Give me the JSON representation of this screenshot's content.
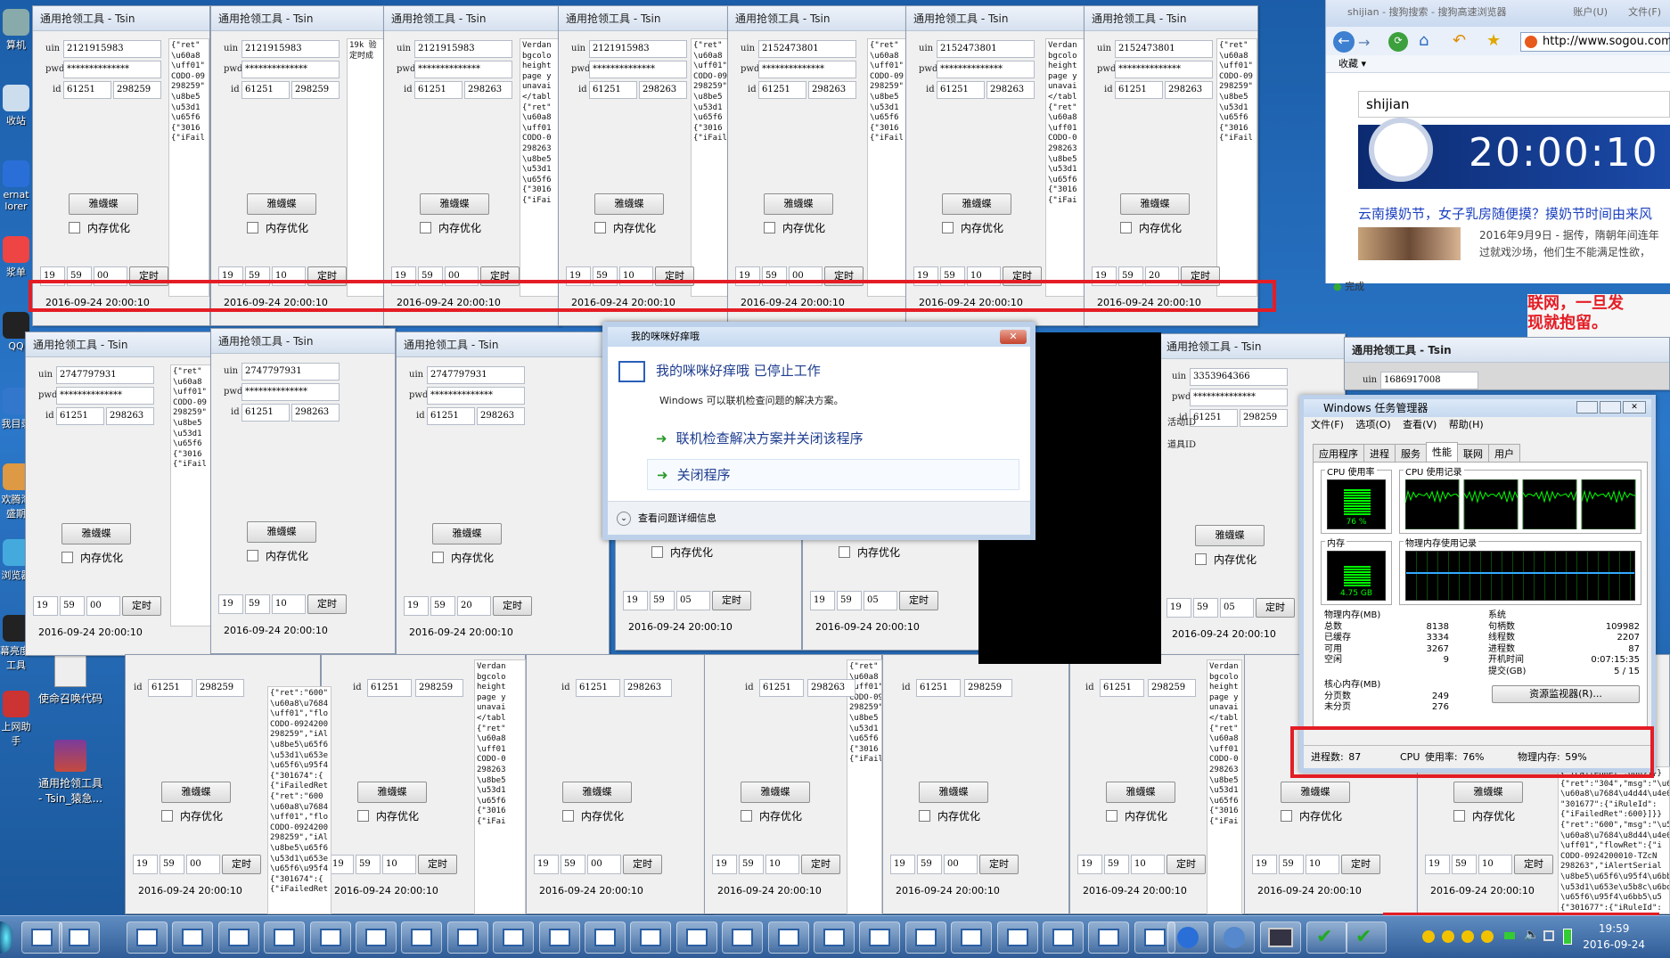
{
  "desktop": {
    "icons": [
      "算机",
      "收站",
      "ernat\nlorer",
      "浆单",
      "QQ",
      "我目录",
      "欢腾淘\n盛期",
      "浏览器",
      "幕亮度调\n工具",
      "上网助\n手"
    ],
    "icons_named": [
      {
        "label": "使命召唤代码"
      },
      {
        "label": "通用抢领工具\n- Tsin_猿急..."
      }
    ]
  },
  "tool": {
    "title": "通用抢领工具 - Tsin",
    "uin_label": "uin",
    "pwd_label": "pwd",
    "id_label": "id",
    "act_label": "活动ID",
    "item_label": "道具ID",
    "pwd_value": "**************",
    "button": "雅蠛蝶",
    "checkbox": "内存优化",
    "timer_button": "定时",
    "datetime": "2016-09-24 20:00:10",
    "log_a": "{\"ret\"\n\\u60a8\n\\uff01\"\nCODO-09\n298259\"\n\\u8be5\n\\u53d1\n\\u65f6\n{\"3016\n{\"iFail",
    "log_b": "Verdan\nbgcolo\nheight\npage y\nunavai\n</tabl\n{\"ret\"\n\\u60a8\n\\uff01\nCODO-0\n298263\n\\u8be5\n\\u53d1\n\\u65f6\n{\"3016\n{\"iFai",
    "log_c": "19k 验\n定时成",
    "windows": [
      {
        "uin": "2121915983",
        "id1": "61251",
        "id2": "298259",
        "h": "19",
        "m": "59",
        "s": "00"
      },
      {
        "uin": "2121915983",
        "id1": "61251",
        "id2": "298259",
        "h": "19",
        "m": "59",
        "s": "10"
      },
      {
        "uin": "2121915983",
        "id1": "61251",
        "id2": "298263",
        "h": "19",
        "m": "59",
        "s": "00"
      },
      {
        "uin": "2121915983",
        "id1": "61251",
        "id2": "298263",
        "h": "19",
        "m": "59",
        "s": "10"
      },
      {
        "uin": "2152473801",
        "id1": "61251",
        "id2": "298263",
        "h": "19",
        "m": "59",
        "s": "00"
      },
      {
        "uin": "2152473801",
        "id1": "61251",
        "id2": "298263",
        "h": "19",
        "m": "59",
        "s": "10"
      },
      {
        "uin": "2152473801",
        "id1": "61251",
        "id2": "298263",
        "h": "19",
        "m": "59",
        "s": "20"
      },
      {
        "uin": "2747797931",
        "id1": "61251",
        "id2": "298263",
        "h": "19",
        "m": "59",
        "s": "00"
      },
      {
        "uin": "2747797931",
        "id1": "61251",
        "id2": "298263",
        "h": "19",
        "m": "59",
        "s": "10"
      },
      {
        "uin": "2747797931",
        "id1": "61251",
        "id2": "298263",
        "h": "19",
        "m": "59",
        "s": "20"
      },
      {
        "uin": "3353964366",
        "id1": "61251",
        "id2": "298259",
        "h": "19",
        "m": "59",
        "s": "05"
      },
      {
        "uin": "1686917008"
      }
    ],
    "row3_times": [
      {
        "h": "19",
        "m": "59",
        "s": "05"
      },
      {
        "h": "19",
        "m": "59",
        "s": "05"
      },
      {
        "h": "19",
        "m": "59",
        "s": "00"
      },
      {
        "h": "19",
        "m": "59",
        "s": "10"
      },
      {
        "h": "19",
        "m": "59",
        "s": "00"
      },
      {
        "h": "19",
        "m": "59",
        "s": "10"
      },
      {
        "h": "19",
        "m": "59",
        "s": "00"
      },
      {
        "h": "19",
        "m": "59",
        "s": "10"
      },
      {
        "h": "19",
        "m": "59",
        "s": "10"
      },
      {
        "h": "19",
        "m": "59",
        "s": "00"
      },
      {
        "h": "19",
        "m": "59",
        "s": "10"
      }
    ],
    "row3_ids": [
      "298259",
      "298259",
      "298263",
      "298263",
      "298259",
      "298259"
    ],
    "log_d": "{\"ret\":\"600\"\n\\u60a8\\u7684\n\\uff01\",\"flo\nCODO-0924200\n298259\",\"iAl\n\\u8be5\\u65f6\n\\u53d1\\u653e\n\\u65f6\\u95f4\n{\"301674\":{\n{\"iFailedRet\n{\"ret\":\"600\n\\u60a8\\u7684\n\\uff01\",\"flo\nCODO-0924200\n298259\",\"iAl\n\\u8be5\\u65f6\n\\u53d1\\u653e\n\\u65f6\\u95f4\n{\"301674\":{\n{\"iFailedRet",
    "log_e": "{\"iFailedRet\":600}]}}\n{\"ret\":\"304\",\"msg\":\"\\u62b1\\u6b49\\uff0c\n\\u60a8\\u7684\\u4d44\\u4e0e\n\"301677\":{\"iRuleId\":\n{\"iFailedRet\":600}]}}\n{\"ret\":\"600\",\"msg\":\"\\u53d1\n\\u60a8\\u7684\\u8d44\\u4e0e\n\\uff01\",\"flowRet\":{\"i\nCODO-0924200010-TZcN\n298263\",\"iAlertSerial\n\\u8be5\\u65f6\\u95f4\\u6bb5\n\\u53d1\\u653e\\u5b8c\\u6bd5\n\\u65f6\\u95f4\\u6bb5\\u5\n{\"301677\":{\"iRuleId\":\n{\"iFailedRet\":600}]}}"
  },
  "dialog": {
    "title": "我的咪咪好痒哦",
    "heading": "我的咪咪好痒哦 已停止工作",
    "subtitle": "Windows 可以联机检查问题的解决方案。",
    "option1": "联机检查解决方案并关闭该程序",
    "option2": "关闭程序",
    "details": "查看问题详细信息",
    "close": "✕"
  },
  "taskmgr": {
    "title": "Windows 任务管理器",
    "menu": [
      "文件(F)",
      "选项(O)",
      "查看(V)",
      "帮助(H)"
    ],
    "tabs": [
      "应用程序",
      "进程",
      "服务",
      "性能",
      "联网",
      "用户"
    ],
    "active_tab": "性能",
    "cpu_label": "CPU 使用率",
    "cpu_value": "76 %",
    "cpu_hist_label": "CPU 使用记录",
    "mem_label": "内存",
    "mem_value": "4.75 GB",
    "mem_hist_label": "物理内存使用记录",
    "phys_label": "物理内存(MB)",
    "phys": [
      {
        "k": "总数",
        "v": "8138"
      },
      {
        "k": "已缓存",
        "v": "3334"
      },
      {
        "k": "可用",
        "v": "3267"
      },
      {
        "k": "空闲",
        "v": "9"
      }
    ],
    "kernel_label": "核心内存(MB)",
    "kernel": [
      {
        "k": "分页数",
        "v": "249"
      },
      {
        "k": "未分页",
        "v": "276"
      }
    ],
    "sys_label": "系统",
    "sys": [
      {
        "k": "句柄数",
        "v": "109982"
      },
      {
        "k": "线程数",
        "v": "2207"
      },
      {
        "k": "进程数",
        "v": "87"
      },
      {
        "k": "开机时间",
        "v": "0:07:15:35"
      },
      {
        "k": "提交(GB)",
        "v": "5 / 15"
      }
    ],
    "resmon": "资源监视器(R)...",
    "status": {
      "processes": "进程数: 87",
      "cpu": "CPU 使用率: 76%",
      "mem": "物理内存: 59%"
    },
    "cpu_percent": 76,
    "mem_percent": 59
  },
  "browser": {
    "tab": "shijian - 搜狗搜索 - 搜狗高速浏览器",
    "menu": [
      "账户(U)",
      "文件(F)"
    ],
    "url": "http://www.sogou.com",
    "favorites": "收藏",
    "search": "shijian",
    "clock": "20:00:10",
    "news_title": "云南摸奶节，女子乳房随便摸？摸奶节时间由来风",
    "news_date": "2016年9月9日 - 据传，隋朝年间连年",
    "news_text": "过就戏沙场，他们生不能满足性欲，",
    "status": "完成",
    "ad": "联网，一旦发\n现就抱留。"
  },
  "taskbar": {
    "time": "19:59",
    "date": "2016-09-24"
  },
  "colors": {
    "highlight": "#e41d25",
    "desktop": "#2b77c9",
    "graph": "#00ff00"
  }
}
